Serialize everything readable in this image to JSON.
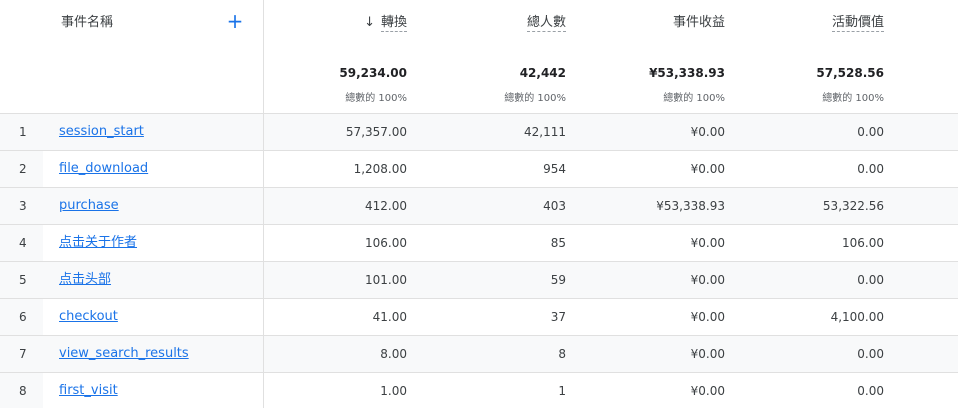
{
  "header": {
    "event_name_label": "事件名稱",
    "add_icon": "plus-icon",
    "sort_icon": "arrow-down-icon",
    "columns": [
      {
        "label": "轉換",
        "total": "59,234.00",
        "pct": "總數的 100%"
      },
      {
        "label": "總人數",
        "total": "42,442",
        "pct": "總數的 100%"
      },
      {
        "label": "事件收益",
        "total": "¥53,338.93",
        "pct": "總數的 100%"
      },
      {
        "label": "活動價值",
        "total": "57,528.56",
        "pct": "總數的 100%"
      }
    ]
  },
  "rows": [
    {
      "idx": "1",
      "name": "session_start",
      "conv": "57,357.00",
      "users": "42,111",
      "revenue": "¥0.00",
      "value": "0.00"
    },
    {
      "idx": "2",
      "name": "file_download",
      "conv": "1,208.00",
      "users": "954",
      "revenue": "¥0.00",
      "value": "0.00"
    },
    {
      "idx": "3",
      "name": "purchase",
      "conv": "412.00",
      "users": "403",
      "revenue": "¥53,338.93",
      "value": "53,322.56"
    },
    {
      "idx": "4",
      "name": "点击关于作者",
      "conv": "106.00",
      "users": "85",
      "revenue": "¥0.00",
      "value": "106.00"
    },
    {
      "idx": "5",
      "name": "点击头部",
      "conv": "101.00",
      "users": "59",
      "revenue": "¥0.00",
      "value": "0.00"
    },
    {
      "idx": "6",
      "name": "checkout",
      "conv": "41.00",
      "users": "37",
      "revenue": "¥0.00",
      "value": "4,100.00"
    },
    {
      "idx": "7",
      "name": "view_search_results",
      "conv": "8.00",
      "users": "8",
      "revenue": "¥0.00",
      "value": "0.00"
    },
    {
      "idx": "8",
      "name": "first_visit",
      "conv": "1.00",
      "users": "1",
      "revenue": "¥0.00",
      "value": "0.00"
    }
  ]
}
